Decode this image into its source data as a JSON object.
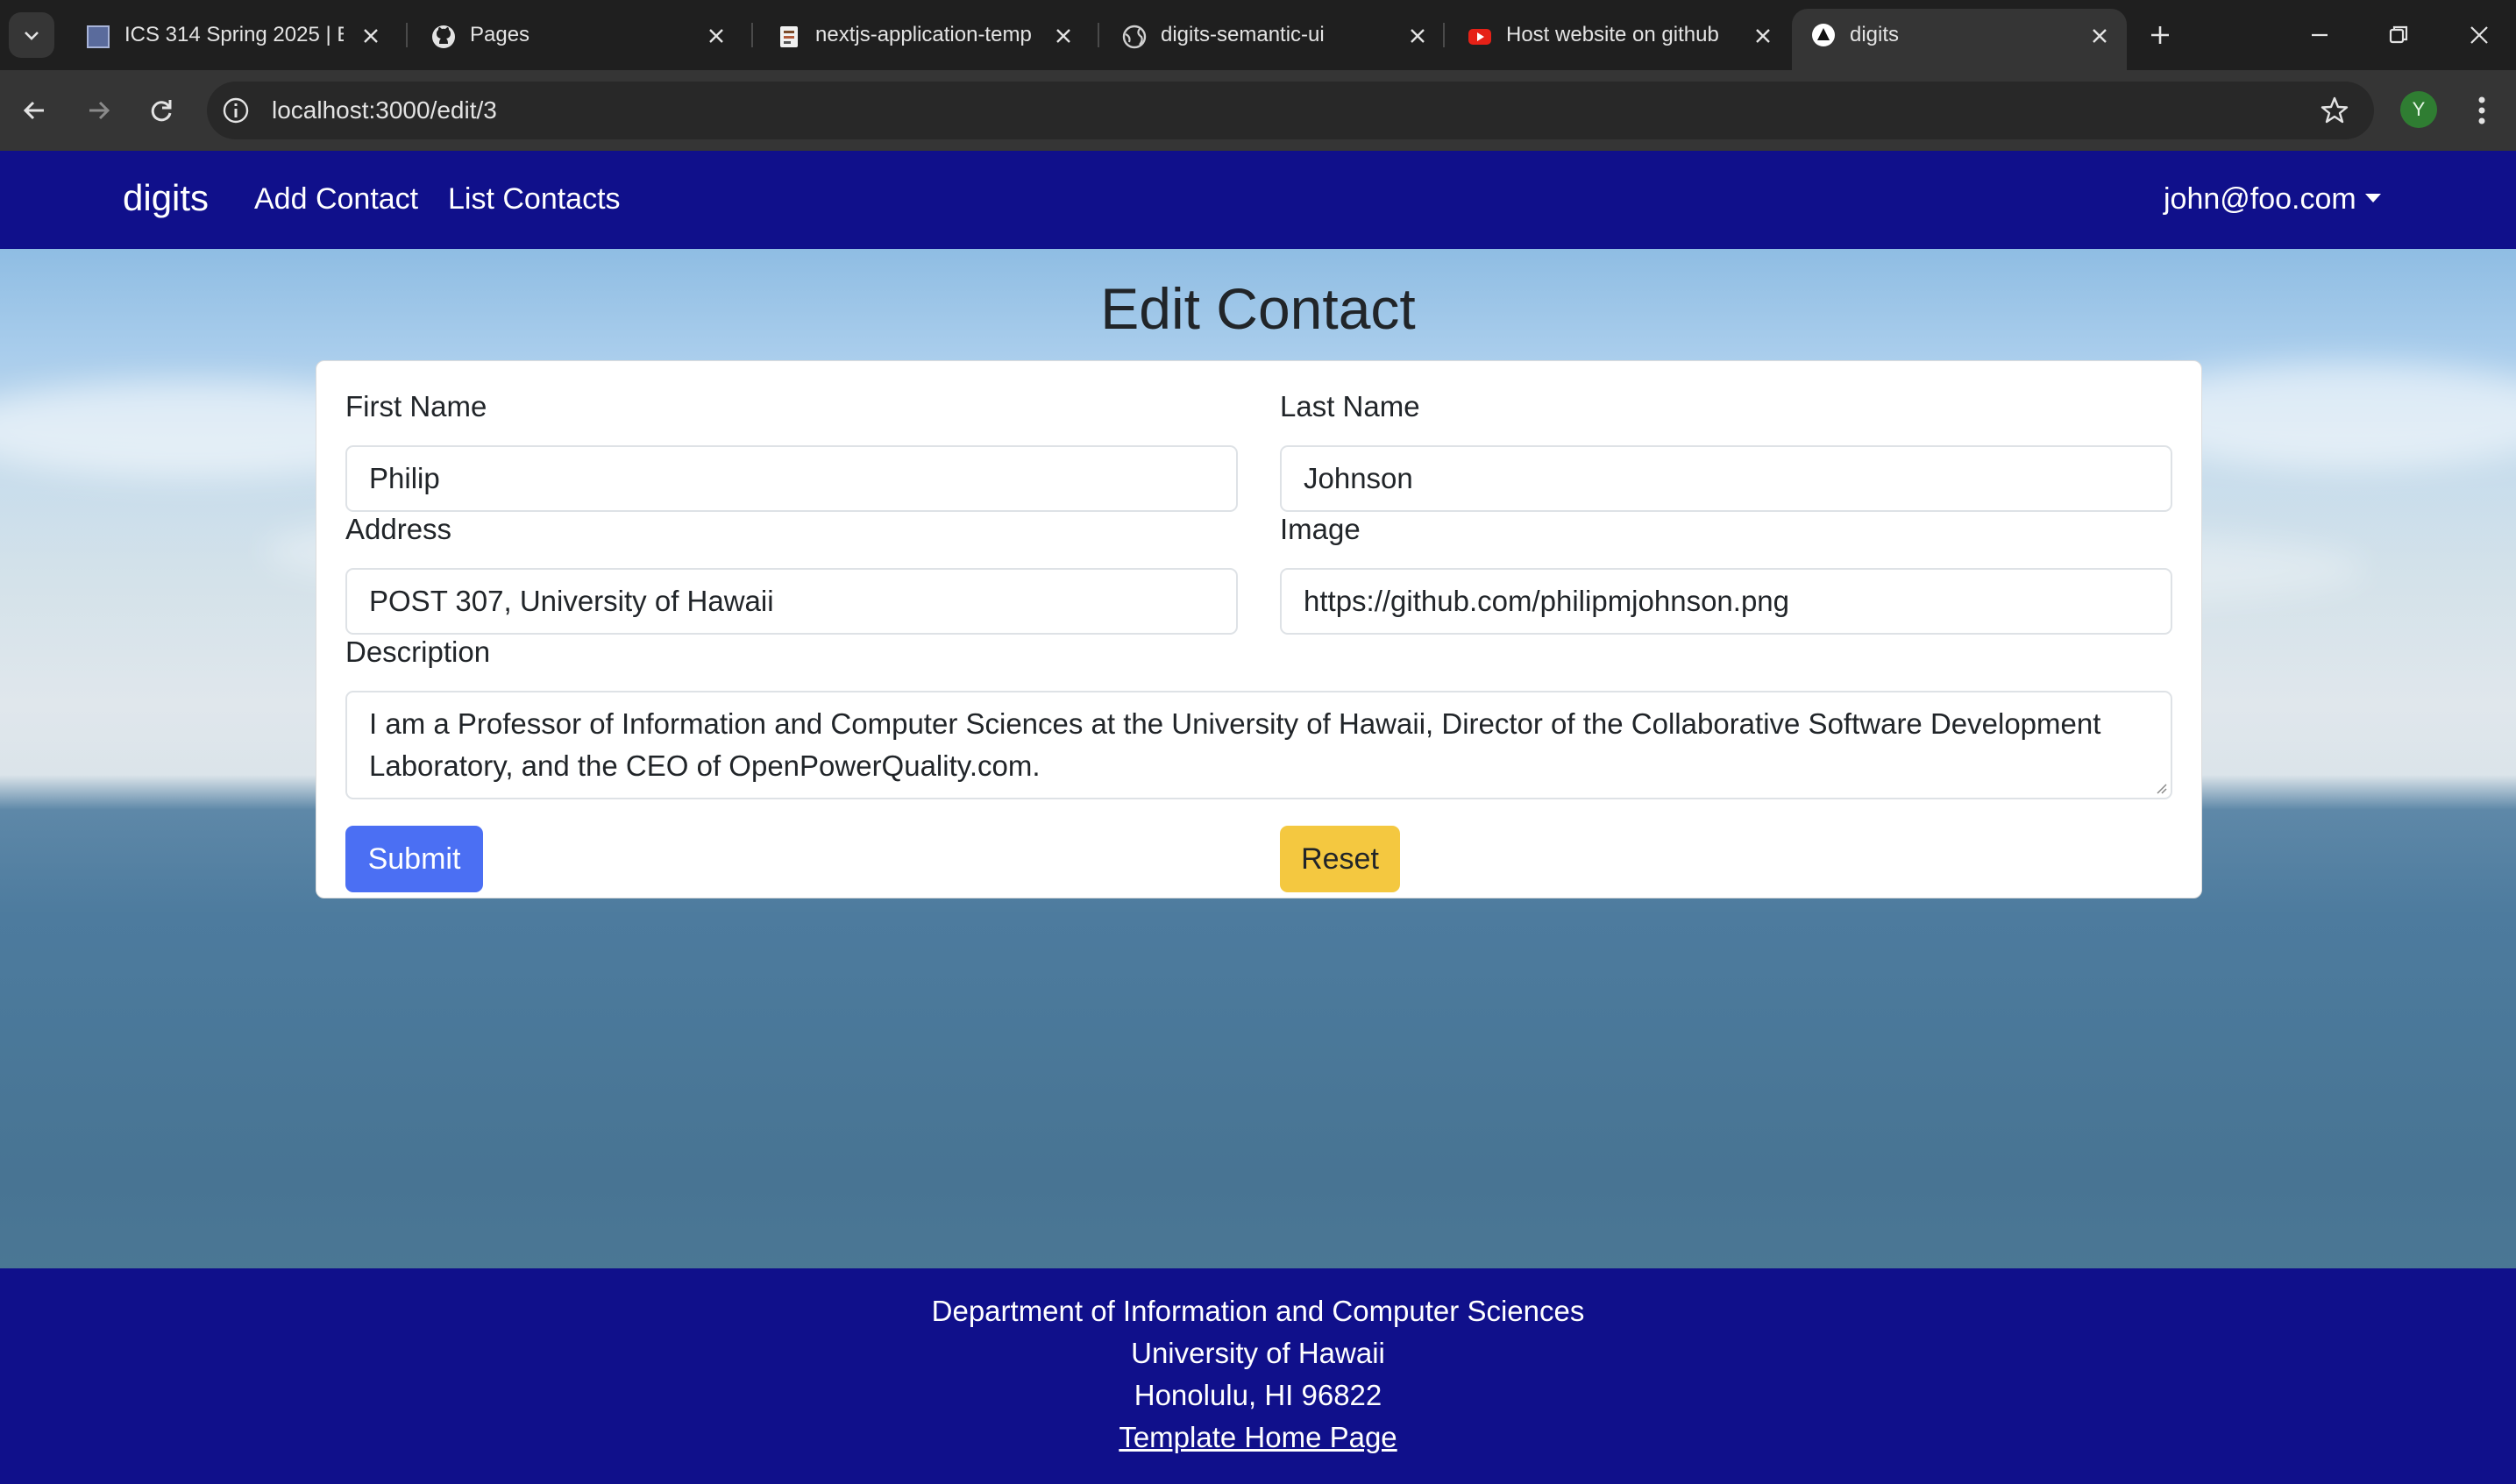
{
  "browser": {
    "tabs": [
      {
        "title": "ICS 314 Spring 2025 | E",
        "favicon": "ics-favicon"
      },
      {
        "title": "Pages",
        "favicon": "github-icon"
      },
      {
        "title": "nextjs-application-temp",
        "favicon": "doc-favicon"
      },
      {
        "title": "digits-semantic-ui",
        "favicon": "globe-icon"
      },
      {
        "title": "Host website on github",
        "favicon": "youtube-icon"
      },
      {
        "title": "digits",
        "favicon": "nextjs-favicon",
        "active": true
      }
    ],
    "url": "localhost:3000/edit/3",
    "profile_initial": "Y"
  },
  "navbar": {
    "brand": "digits",
    "links": [
      "Add Contact",
      "List Contacts"
    ],
    "user": "john@foo.com"
  },
  "page": {
    "title": "Edit Contact"
  },
  "form": {
    "first_name": {
      "label": "First Name",
      "value": "Philip"
    },
    "last_name": {
      "label": "Last Name",
      "value": "Johnson"
    },
    "address": {
      "label": "Address",
      "value": "POST 307, University of Hawaii"
    },
    "image": {
      "label": "Image",
      "value": "https://github.com/philipmjohnson.png"
    },
    "description": {
      "label": "Description",
      "value": "I am a Professor of Information and Computer Sciences at the University of Hawaii, Director of the Collaborative Software Development Laboratory, and the CEO of OpenPowerQuality.com."
    },
    "submit_label": "Submit",
    "reset_label": "Reset"
  },
  "footer": {
    "lines": [
      "Department of Information and Computer Sciences",
      "University of Hawaii",
      "Honolulu, HI 96822"
    ],
    "link": "Template Home Page"
  },
  "colors": {
    "navbar": "#10108b",
    "submit": "#4b6ff3",
    "reset": "#f4c840"
  }
}
